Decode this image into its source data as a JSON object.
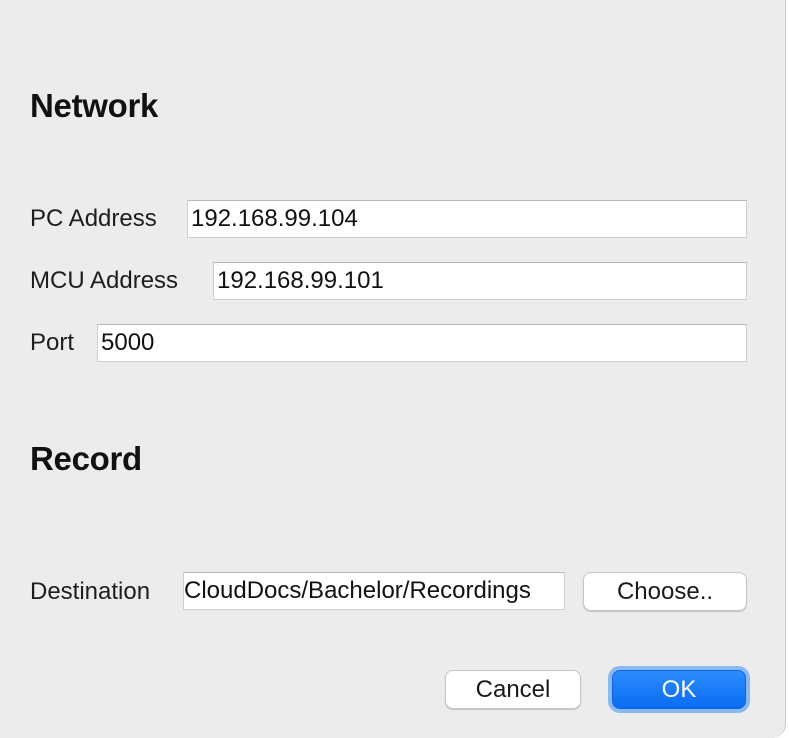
{
  "network": {
    "heading": "Network",
    "pc_address_label": "PC Address",
    "pc_address_value": "192.168.99.104",
    "mcu_address_label": "MCU Address",
    "mcu_address_value": "192.168.99.101",
    "port_label": "Port",
    "port_value": "5000"
  },
  "record": {
    "heading": "Record",
    "destination_label": "Destination",
    "destination_value": "CloudDocs/Bachelor/Recordings",
    "choose_label": "Choose.."
  },
  "buttons": {
    "cancel_label": "Cancel",
    "ok_label": "OK"
  },
  "colors": {
    "accent": "#0a6cf2",
    "background": "#ececec"
  }
}
